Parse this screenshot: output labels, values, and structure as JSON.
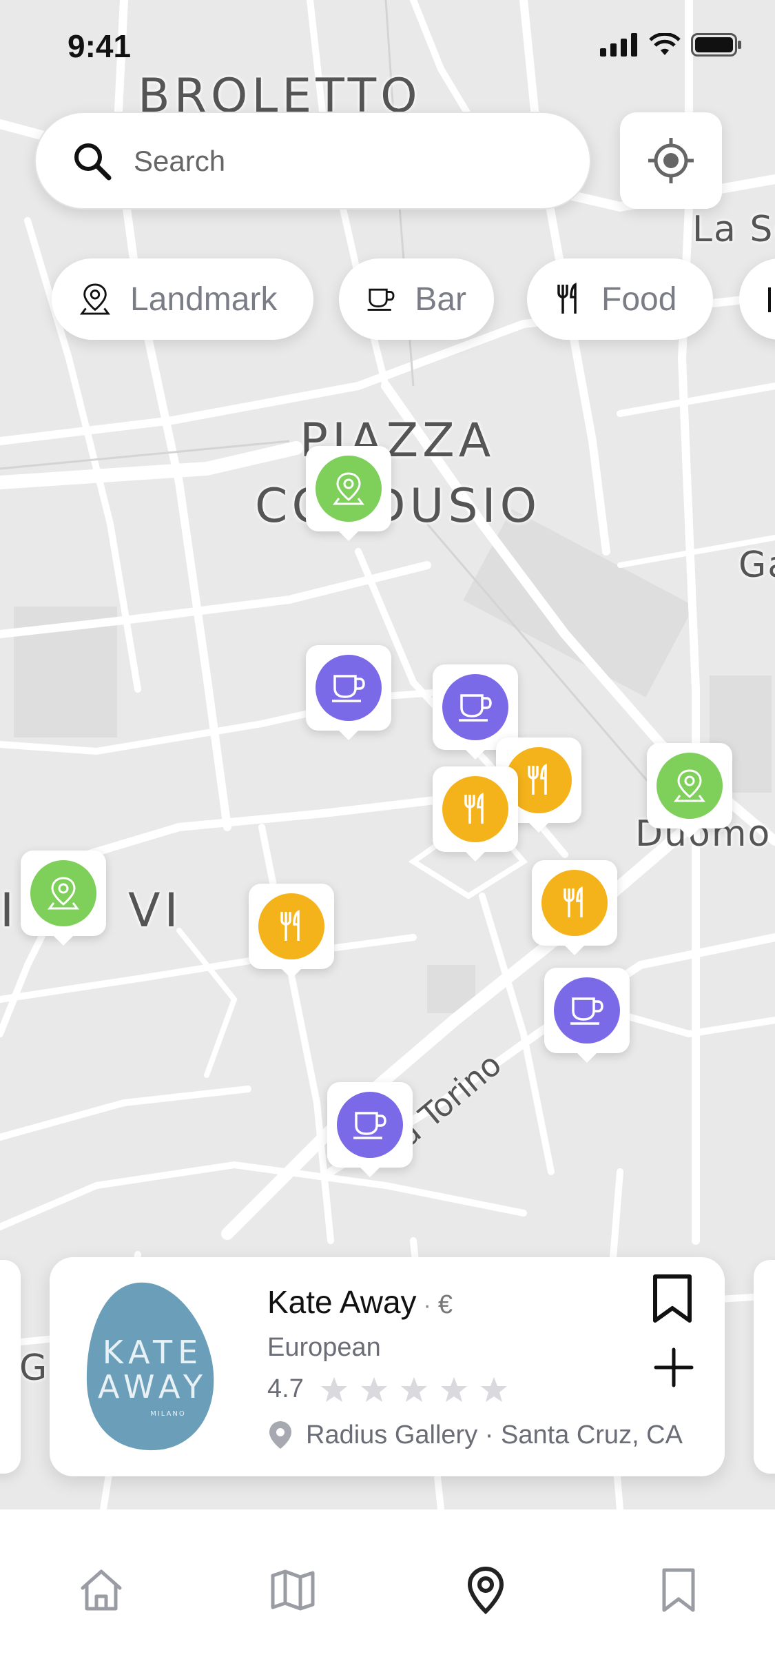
{
  "status_bar": {
    "time": "9:41"
  },
  "search": {
    "placeholder": "Search"
  },
  "map": {
    "labels": {
      "broletto": "BROLETTO",
      "piazza_line1": "PIAZZA",
      "piazza_line2": "CORDUSIO",
      "la_sc": "La Sc",
      "duomo": "Duomo",
      "cinque_vie": "I UE VI",
      "ga": "Ga",
      "g": "G",
      "via_torino": "a Torino"
    }
  },
  "filters": [
    {
      "label": "Landmark",
      "icon": "landmark-pin-icon"
    },
    {
      "label": "Bar",
      "icon": "coffee-cup-icon"
    },
    {
      "label": "Food",
      "icon": "fork-knife-icon"
    }
  ],
  "map_pins": [
    {
      "type": "landmark",
      "color": "#7fcf5b"
    },
    {
      "type": "bar",
      "color": "#7a6ae8"
    },
    {
      "type": "bar",
      "color": "#7a6ae8"
    },
    {
      "type": "food",
      "color": "#f5b31b"
    },
    {
      "type": "food",
      "color": "#f5b31b"
    },
    {
      "type": "landmark",
      "color": "#7fcf5b"
    },
    {
      "type": "landmark",
      "color": "#7fcf5b"
    },
    {
      "type": "food",
      "color": "#f5b31b"
    },
    {
      "type": "food",
      "color": "#f5b31b"
    },
    {
      "type": "bar",
      "color": "#7a6ae8"
    },
    {
      "type": "bar",
      "color": "#7a6ae8"
    }
  ],
  "place_card": {
    "title": "Kate Away",
    "separator": "·",
    "price": "€",
    "cuisine": "European",
    "rating": "4.7",
    "stars": 5,
    "address": "Radius Gallery · Santa Cruz, CA",
    "logo": {
      "line1": "KATE",
      "line2": "AWAY",
      "line3": "MILANO",
      "color": "#6b9fb9"
    }
  },
  "tab_bar": {
    "items": [
      {
        "icon": "home-icon",
        "active": false
      },
      {
        "icon": "map-icon",
        "active": false
      },
      {
        "icon": "location-pin-icon",
        "active": true
      },
      {
        "icon": "bookmark-icon",
        "active": false
      }
    ]
  },
  "colors": {
    "landmark": "#7fcf5b",
    "bar": "#7a6ae8",
    "food": "#f5b31b",
    "active_tab": "#222222",
    "inactive_tab": "#9a9ca3"
  }
}
